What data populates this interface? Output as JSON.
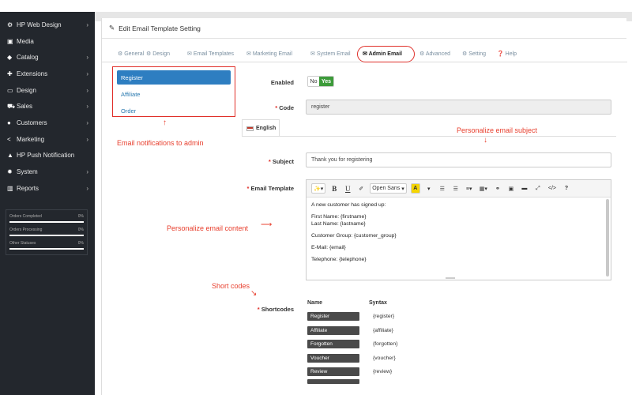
{
  "sidebar": {
    "items": [
      {
        "icon": "gears-icon",
        "glyph": "⚙",
        "label": "HP Web Design",
        "chevron": true
      },
      {
        "icon": "image-icon",
        "glyph": "▣",
        "label": "Media",
        "chevron": false
      },
      {
        "icon": "tag-icon",
        "glyph": "◆",
        "label": "Catalog",
        "chevron": true
      },
      {
        "icon": "puzzle-icon",
        "glyph": "✚",
        "label": "Extensions",
        "chevron": true
      },
      {
        "icon": "monitor-icon",
        "glyph": "▭",
        "label": "Design",
        "chevron": true
      },
      {
        "icon": "cart-icon",
        "glyph": "⛟",
        "label": "Sales",
        "chevron": true
      },
      {
        "icon": "user-icon",
        "glyph": "●",
        "label": "Customers",
        "chevron": true
      },
      {
        "icon": "share-icon",
        "glyph": "<",
        "label": "Marketing",
        "chevron": true
      },
      {
        "icon": "bell-icon",
        "glyph": "▲",
        "label": "HP Push Notification",
        "chevron": false
      },
      {
        "icon": "cog-icon",
        "glyph": "✹",
        "label": "System",
        "chevron": true
      },
      {
        "icon": "bar-chart-icon",
        "glyph": "▥",
        "label": "Reports",
        "chevron": true
      }
    ],
    "stats": [
      {
        "label": "Orders Completed",
        "value": "0%"
      },
      {
        "label": "Orders Processing",
        "value": "0%"
      },
      {
        "label": "Other Statuses",
        "value": "0%"
      }
    ]
  },
  "panel": {
    "title": "Edit Email Template Setting",
    "tabs": [
      {
        "label": "General",
        "glyph": "⚙",
        "active": false
      },
      {
        "label": "Design",
        "glyph": "⚙",
        "active": false
      },
      {
        "label": "Email Templates",
        "glyph": "✉",
        "active": false
      },
      {
        "label": "Marketing Email",
        "glyph": "✉",
        "active": false
      },
      {
        "label": "System Email",
        "glyph": "✉",
        "active": false
      },
      {
        "label": "Admin Email",
        "glyph": "✉",
        "active": true
      },
      {
        "label": "Advanced",
        "glyph": "⚙",
        "active": false
      },
      {
        "label": "Setting",
        "glyph": "⚙",
        "active": false
      },
      {
        "label": "Help",
        "glyph": "❓",
        "active": false
      }
    ]
  },
  "notifications": {
    "items": [
      {
        "label": "Register",
        "active": true
      },
      {
        "label": "Affiliate",
        "active": false
      },
      {
        "label": "Order",
        "active": false
      }
    ]
  },
  "form": {
    "enabled_label": "Enabled",
    "toggle_no": "No",
    "toggle_yes": "Yes",
    "code_label": "Code",
    "code_value": "register",
    "language_tab": "English",
    "subject_label": "Subject",
    "subject_value": "Thank you for registering",
    "template_label": "Email Template",
    "font_name": "Open Sans",
    "body": {
      "line1": "A new customer has signed up:",
      "line2": "First Name: {firstname}",
      "line3": "Last Name: {lastname}",
      "line4": "Customer Group: {customer_group}",
      "line5": "E-Mail: {email}",
      "line6": "Telephone: {telephone}"
    },
    "shortcodes_label": "Shortcodes",
    "shortcodes_name_header": "Name",
    "shortcodes_syntax_header": "Syntax",
    "shortcodes": [
      {
        "name": "Register",
        "syntax": "{register}"
      },
      {
        "name": "Affiliate",
        "syntax": "{affiliate}"
      },
      {
        "name": "Forgotten",
        "syntax": "{forgotten}"
      },
      {
        "name": "Voucher",
        "syntax": "{voucher}"
      },
      {
        "name": "Review",
        "syntax": "{review}"
      }
    ]
  },
  "annotations": {
    "notifications": "Email notifications to admin",
    "subject": "Personalize email subject",
    "content": "Personalize email content",
    "shortcodes": "Short codes"
  },
  "colors": {
    "sidebar_bg": "#23272d",
    "accent_blue": "#2e7ec1",
    "annotation_red": "#e8402f",
    "toggle_green": "#3d9b3a"
  }
}
